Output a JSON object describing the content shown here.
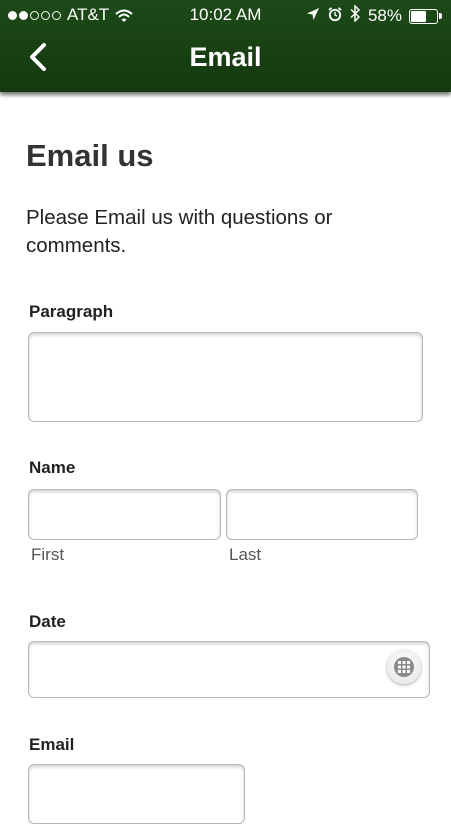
{
  "status_bar": {
    "carrier": "AT&T",
    "time": "10:02 AM",
    "battery_percent_label": "58%",
    "battery_level": 0.58,
    "signal_bars_filled": 2,
    "signal_bars_total": 5,
    "icons": [
      "wifi-icon",
      "location-arrow-icon",
      "alarm-icon",
      "bluetooth-icon",
      "battery-icon"
    ]
  },
  "nav": {
    "title": "Email",
    "back_icon": "chevron-left-icon"
  },
  "page": {
    "title": "Email us",
    "intro": "Please Email us with questions or comments."
  },
  "form": {
    "paragraph": {
      "label": "Paragraph",
      "value": ""
    },
    "name": {
      "label": "Name",
      "first_sublabel": "First",
      "last_sublabel": "Last",
      "first_value": "",
      "last_value": ""
    },
    "date": {
      "label": "Date",
      "value": "",
      "picker_icon": "calendar-grid-icon"
    },
    "email": {
      "label": "Email",
      "value": ""
    }
  },
  "colors": {
    "header_background": "#1a4315",
    "header_text": "#ffffff",
    "page_background": "#ffffff"
  }
}
